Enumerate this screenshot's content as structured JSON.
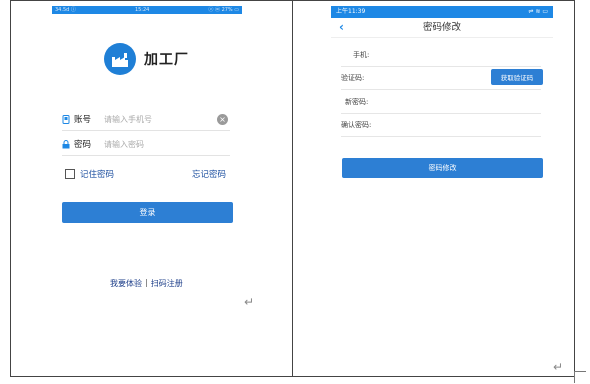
{
  "left_screen": {
    "status_bar": {
      "left": "34.5d ⓘ",
      "time": "15:24",
      "right": "ⓥ ⓦ 27% ▭"
    },
    "app_name": "加工厂",
    "account_label": "账号",
    "account_placeholder": "请输入手机号",
    "password_label": "密码",
    "password_placeholder": "请输入密码",
    "remember_label": "记住密码",
    "forgot_label": "忘记密码",
    "login_label": "登录",
    "experience_link": "我要体验",
    "separator": "|",
    "register_link": "扫码注册"
  },
  "right_screen": {
    "status_bar": {
      "time": "上午11:39",
      "right": "⇌ ≋ ▭"
    },
    "back_symbol": "‹",
    "title": "密码修改",
    "phone_label": "手机:",
    "code_label": "验证码:",
    "get_code_label": "获取验证码",
    "new_password_label": "新密码:",
    "confirm_password_label": "确认密码:",
    "submit_label": "密码修改"
  },
  "marks": {
    "return_symbol": "↵"
  },
  "colors": {
    "primary": "#2d7fd4",
    "status_bar": "#1e88e5",
    "link": "#1e50a0"
  }
}
